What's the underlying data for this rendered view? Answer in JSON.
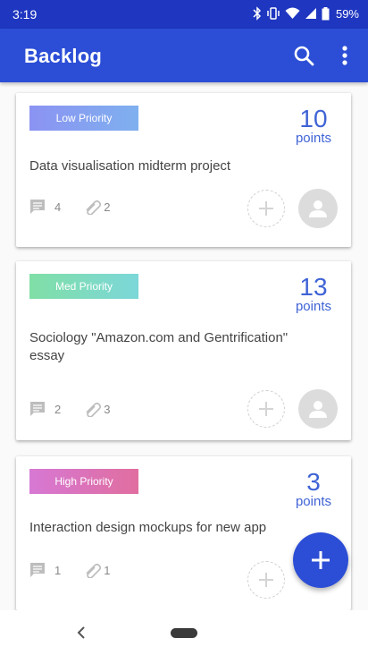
{
  "status_bar": {
    "time": "3:19",
    "battery": "59%",
    "icons": [
      "bluetooth-icon",
      "vibrate-icon",
      "wifi-icon",
      "signal-icon",
      "battery-icon"
    ]
  },
  "app_bar": {
    "title": "Backlog",
    "actions": [
      "search-icon",
      "more-vert-icon"
    ],
    "color": "#2c4ed6"
  },
  "cards": [
    {
      "priority": "Low Priority",
      "points": "10",
      "points_unit": "points",
      "title": "Data visualisation midterm project",
      "comments": "4",
      "attachments": "2"
    },
    {
      "priority": "Med Priority",
      "points": "13",
      "points_unit": "points",
      "title": "Sociology \"Amazon.com and Gentrification\" essay",
      "comments": "2",
      "attachments": "3"
    },
    {
      "priority": "High Priority",
      "points": "3",
      "points_unit": "points",
      "title": "Interaction design mockups for new app",
      "comments": "1",
      "attachments": "1"
    }
  ],
  "fab": {
    "icon": "add-icon"
  },
  "colors": {
    "accent": "#3f63d6",
    "low": "#8b93f2",
    "med": "#80dfa6",
    "high": "#d778d4"
  }
}
